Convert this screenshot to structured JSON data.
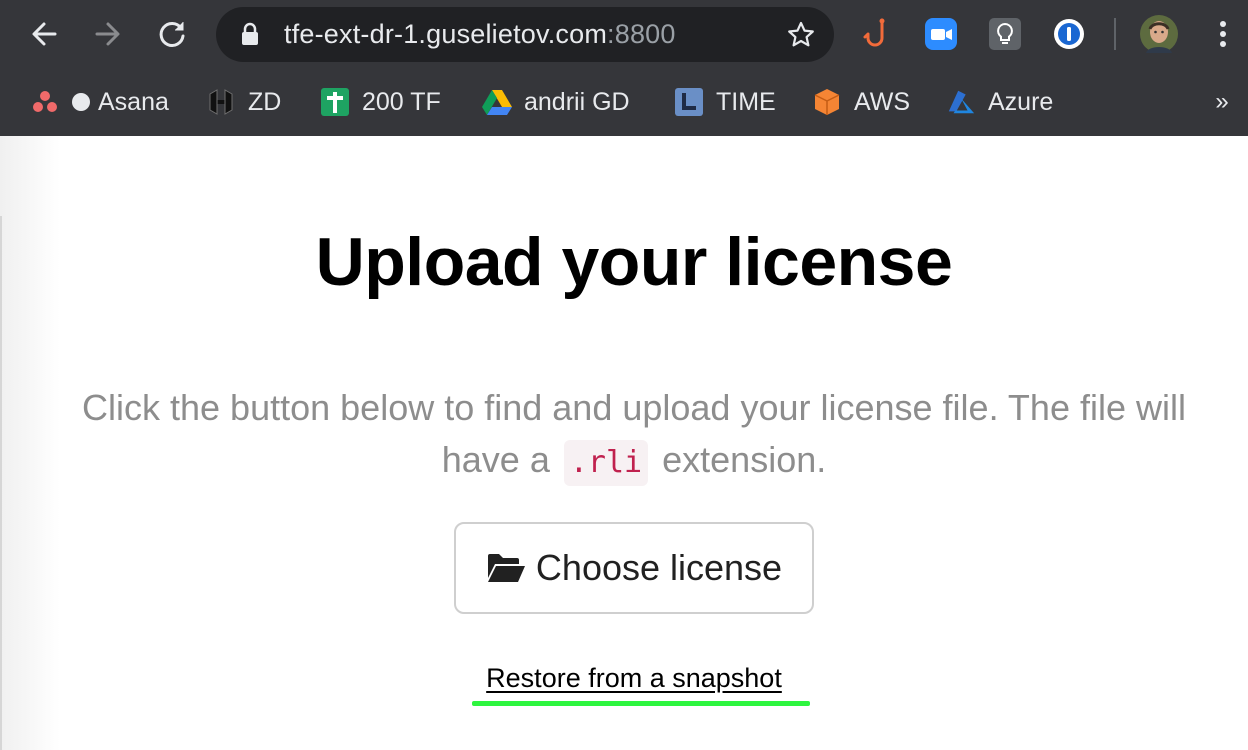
{
  "browser": {
    "url_host": "tfe-ext-dr-1.guselietov.com",
    "url_port": ":8800",
    "extensions": [
      "hook-icon",
      "zoom-icon",
      "lightbulb-icon",
      "1password-icon"
    ],
    "bookmarks": [
      {
        "label": "Asana",
        "icon": "asana-icon"
      },
      {
        "label": "ZD",
        "icon": "hashicorp-icon"
      },
      {
        "label": "200 TF",
        "icon": "sheets-icon"
      },
      {
        "label": "andrii  GD",
        "icon": "google-drive-icon"
      },
      {
        "label": "TIME",
        "icon": "clock-icon"
      },
      {
        "label": "AWS",
        "icon": "aws-cube-icon"
      },
      {
        "label": "Azure",
        "icon": "azure-icon"
      }
    ],
    "more_bookmarks": "»"
  },
  "page": {
    "title": "Upload your license",
    "instructions_before": "Click the button below to find and upload your license file. The file will have a",
    "file_extension": ".rli",
    "instructions_after": "extension.",
    "choose_button_label": "Choose license",
    "restore_link": "Restore from a snapshot"
  },
  "colors": {
    "chrome_bg": "#35363a",
    "omnibox_bg": "#202124",
    "code_text": "#c0214e",
    "highlight": "#2ef53f"
  }
}
